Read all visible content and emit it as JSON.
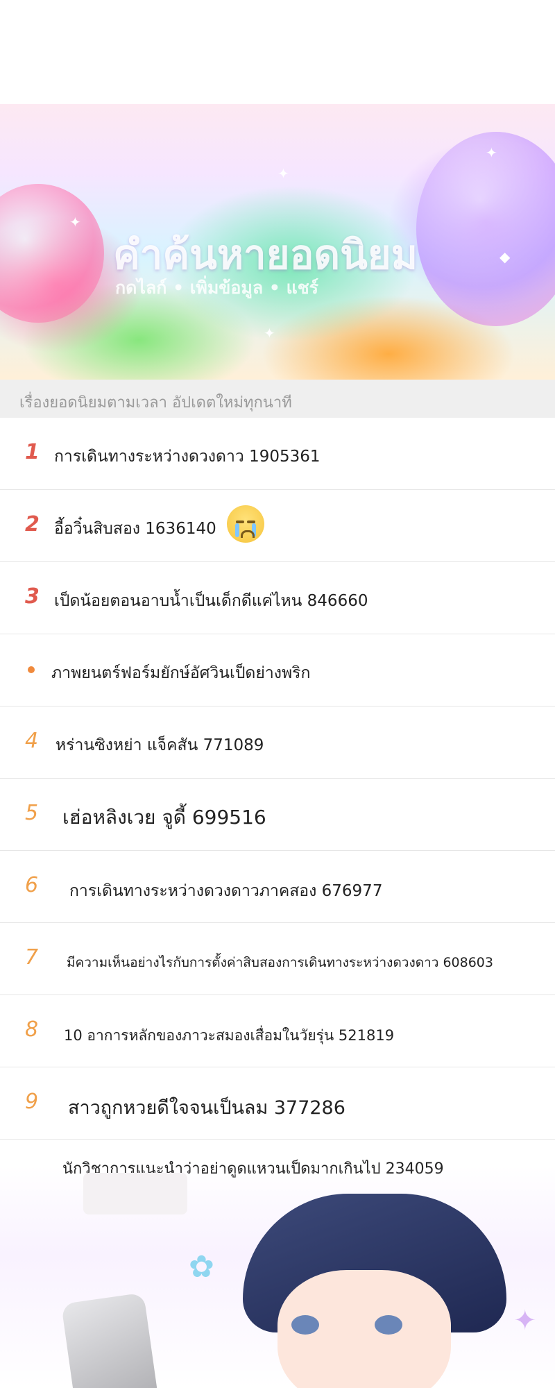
{
  "banner": {
    "title": "คำค้นหายอดนิยม",
    "subtitle": "กดไลก์ • เพิ่มข้อมูล • แชร์"
  },
  "section_header": "เรื่องยอดนิยมตามเวลา อัปเดตใหม่ทุกนาที",
  "trending": [
    {
      "rank": "1",
      "title": "การเดินทางระหว่างดวงดาว 1905361",
      "rank_color": "#e05a4e"
    },
    {
      "rank": "2",
      "title": "อี้อวิ๋นสิบสอง 1636140",
      "rank_color": "#e05a4e",
      "icon": "crying-emoji-icon"
    },
    {
      "rank": "3",
      "title": "เป็ดน้อยตอนอาบน้ำเป็นเด็กดีแค่ไหน 846660",
      "rank_color": "#e05a4e"
    },
    {
      "rank": "",
      "title": "ภาพยนตร์ฟอร์มยักษ์อัศวินเป็ดย่างพริก",
      "rank_color": "#f08a3c",
      "icon": "dot-icon"
    },
    {
      "rank": "4",
      "title": "หร่านซิงหย่า แจ็คสัน 771089",
      "rank_color": "#f0a04a"
    },
    {
      "rank": "5",
      "title": "เฮ่อหลิงเวย จูดี้ 699516",
      "rank_color": "#f0a04a"
    },
    {
      "rank": "6",
      "title": "การเดินทางระหว่างดวงดาวภาคสอง 676977",
      "rank_color": "#f0a04a"
    },
    {
      "rank": "7",
      "title": "มีความเห็นอย่างไรกับการตั้งค่าสิบสองการเดินทางระหว่างดวงดาว 608603",
      "rank_color": "#f0a04a"
    },
    {
      "rank": "8",
      "title": "10 อาการหลักของภาวะสมองเสื่อมในวัยรุ่น 521819",
      "rank_color": "#f0a04a"
    },
    {
      "rank": "9",
      "title": "สาวถูกหวยดีใจจนเป็นลม 377286",
      "rank_color": "#f0a04a"
    },
    {
      "rank": "",
      "title": "นักวิชาการแนะนำว่าอย่าดูดแหวนเป็ดมากเกินไป 234059",
      "rank_color": "#f0a04a"
    }
  ]
}
